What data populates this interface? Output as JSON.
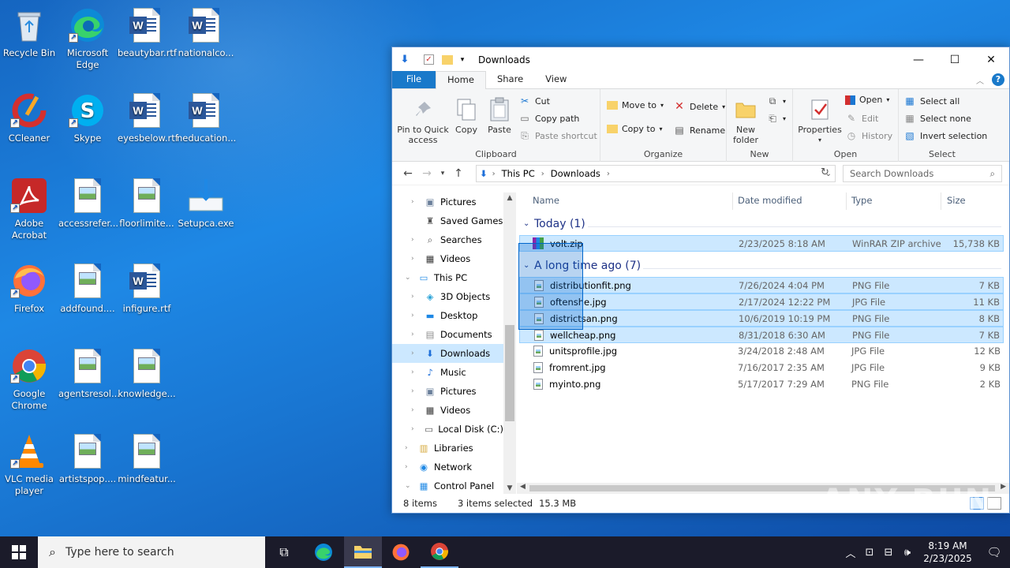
{
  "desktop": {
    "icons": [
      {
        "label": "Recycle Bin"
      },
      {
        "label": "Microsoft Edge"
      },
      {
        "label": "beautybar.rtf"
      },
      {
        "label": "nationalco..."
      },
      {
        "label": "CCleaner"
      },
      {
        "label": "Skype"
      },
      {
        "label": "eyesbelow.rtf"
      },
      {
        "label": "neducation..."
      },
      {
        "label": "Adobe Acrobat"
      },
      {
        "label": "accessrefer..."
      },
      {
        "label": "floorlimite..."
      },
      {
        "label": "Setupca.exe"
      },
      {
        "label": "Firefox"
      },
      {
        "label": "addfound...."
      },
      {
        "label": "infigure.rtf"
      },
      {
        "label": "Google Chrome"
      },
      {
        "label": "agentsresol..."
      },
      {
        "label": "knowledge..."
      },
      {
        "label": "VLC media player"
      },
      {
        "label": "artistspop...."
      },
      {
        "label": "mindfeatur..."
      }
    ]
  },
  "explorer": {
    "title": "Downloads",
    "tabs": {
      "file": "File",
      "home": "Home",
      "share": "Share",
      "view": "View"
    },
    "ribbon": {
      "clipboard": {
        "label": "Clipboard",
        "pin": "Pin to Quick access",
        "copy": "Copy",
        "paste": "Paste",
        "cut": "Cut",
        "copy_path": "Copy path",
        "paste_shortcut": "Paste shortcut"
      },
      "organize": {
        "label": "Organize",
        "move_to": "Move to",
        "copy_to": "Copy to",
        "delete": "Delete",
        "rename": "Rename"
      },
      "new": {
        "label": "New",
        "new_folder": "New folder"
      },
      "open": {
        "label": "Open",
        "properties": "Properties",
        "open": "Open",
        "edit": "Edit",
        "history": "History"
      },
      "select": {
        "label": "Select",
        "select_all": "Select all",
        "select_none": "Select none",
        "invert": "Invert selection"
      }
    },
    "address": {
      "this_pc": "This PC",
      "downloads": "Downloads"
    },
    "search_placeholder": "Search Downloads",
    "nav": [
      {
        "label": "Pictures"
      },
      {
        "label": "Saved Games"
      },
      {
        "label": "Searches"
      },
      {
        "label": "Videos"
      },
      {
        "label": "This PC"
      },
      {
        "label": "3D Objects"
      },
      {
        "label": "Desktop"
      },
      {
        "label": "Documents"
      },
      {
        "label": "Downloads"
      },
      {
        "label": "Music"
      },
      {
        "label": "Pictures"
      },
      {
        "label": "Videos"
      },
      {
        "label": "Local Disk (C:)"
      },
      {
        "label": "Libraries"
      },
      {
        "label": "Network"
      },
      {
        "label": "Control Panel"
      }
    ],
    "columns": {
      "name": "Name",
      "date": "Date modified",
      "type": "Type",
      "size": "Size"
    },
    "groups": [
      {
        "title": "Today (1)",
        "files": [
          {
            "name": "volt.zip",
            "date": "2/23/2025 8:18 AM",
            "type": "WinRAR ZIP archive",
            "size": "15,738 KB"
          }
        ]
      },
      {
        "title": "A long time ago (7)",
        "files": [
          {
            "name": "distributionfit.png",
            "date": "7/26/2024 4:04 PM",
            "type": "PNG File",
            "size": "7 KB"
          },
          {
            "name": "oftenshe.jpg",
            "date": "2/17/2024 12:22 PM",
            "type": "JPG File",
            "size": "11 KB"
          },
          {
            "name": "districtsan.png",
            "date": "10/6/2019 10:19 PM",
            "type": "PNG File",
            "size": "8 KB"
          },
          {
            "name": "wellcheap.png",
            "date": "8/31/2018 6:30 AM",
            "type": "PNG File",
            "size": "7 KB"
          },
          {
            "name": "unitsprofile.jpg",
            "date": "3/24/2018 2:48 AM",
            "type": "JPG File",
            "size": "12 KB"
          },
          {
            "name": "fromrent.jpg",
            "date": "7/16/2017 2:35 AM",
            "type": "JPG File",
            "size": "9 KB"
          },
          {
            "name": "myinto.png",
            "date": "5/17/2017 7:29 AM",
            "type": "PNG File",
            "size": "2 KB"
          }
        ]
      }
    ],
    "status": {
      "items": "8 items",
      "selected": "3 items selected",
      "size": "15.3 MB"
    }
  },
  "watermark": "ANY RUN",
  "taskbar": {
    "search_placeholder": "Type here to search",
    "time": "8:19 AM",
    "date": "2/23/2025"
  },
  "colors": {
    "accent": "#1979ca",
    "selection": "#cce8ff",
    "taskbar": "#1b1b2a"
  }
}
